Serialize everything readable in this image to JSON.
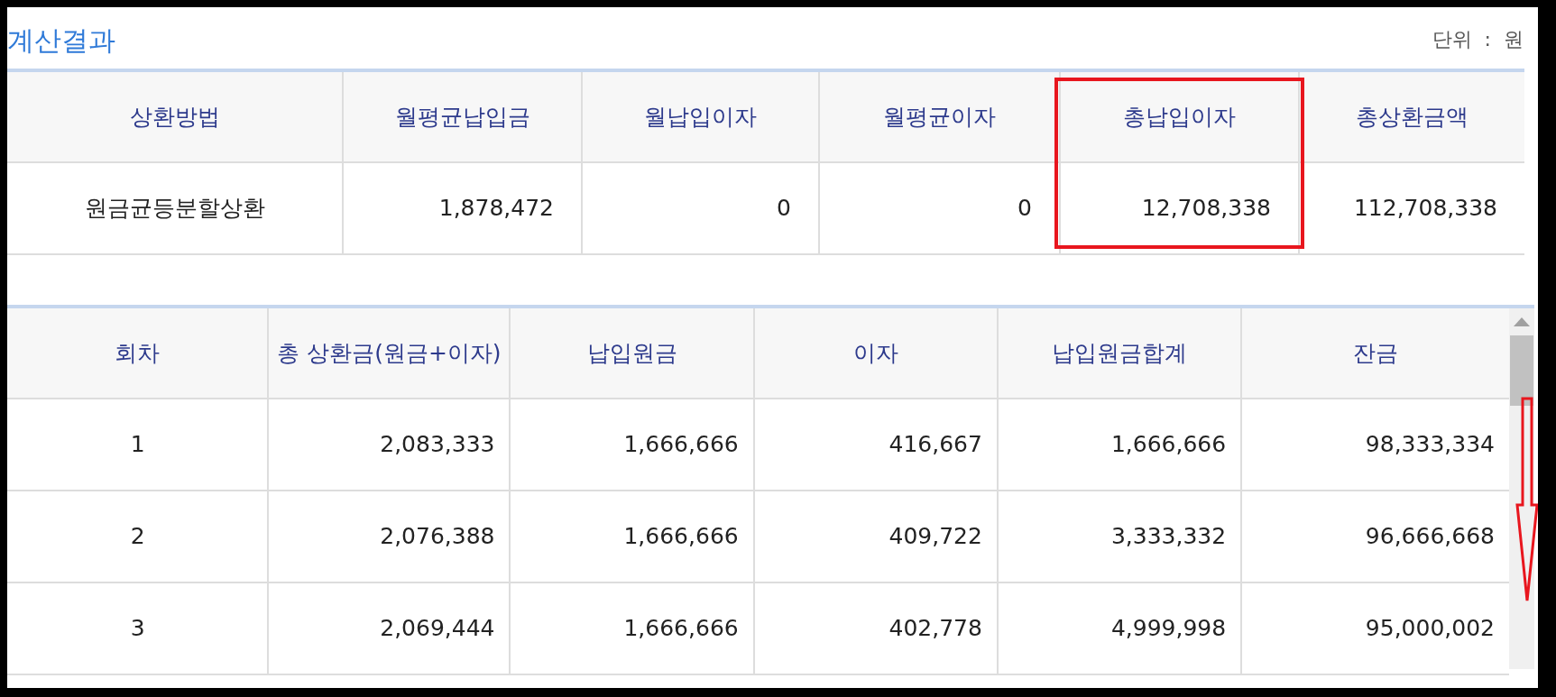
{
  "title": "계산결과",
  "unit": {
    "label": "단위",
    "separator": ":",
    "value": "원"
  },
  "summary": {
    "columns": [
      {
        "header": "상환방법",
        "value": "원금균등분할상환",
        "highlighted": false
      },
      {
        "header": "월평균납입금",
        "value": "1,878,472",
        "highlighted": false
      },
      {
        "header": "월납입이자",
        "value": "0",
        "highlighted": false
      },
      {
        "header": "월평균이자",
        "value": "0",
        "highlighted": false
      },
      {
        "header": "총납입이자",
        "value": "12,708,338",
        "highlighted": true
      },
      {
        "header": "총상환금액",
        "value": "112,708,338",
        "highlighted": false
      }
    ]
  },
  "schedule": {
    "columns": [
      "회차",
      "총 상환금(원금+이자)",
      "납입원금",
      "이자",
      "납입원금합계",
      "잔금"
    ],
    "rows": [
      [
        "1",
        "2,083,333",
        "1,666,666",
        "416,667",
        "1,666,666",
        "98,333,334"
      ],
      [
        "2",
        "2,076,388",
        "1,666,666",
        "409,722",
        "3,333,332",
        "96,666,668"
      ],
      [
        "3",
        "2,069,444",
        "1,666,666",
        "402,778",
        "4,999,998",
        "95,000,002"
      ]
    ]
  }
}
